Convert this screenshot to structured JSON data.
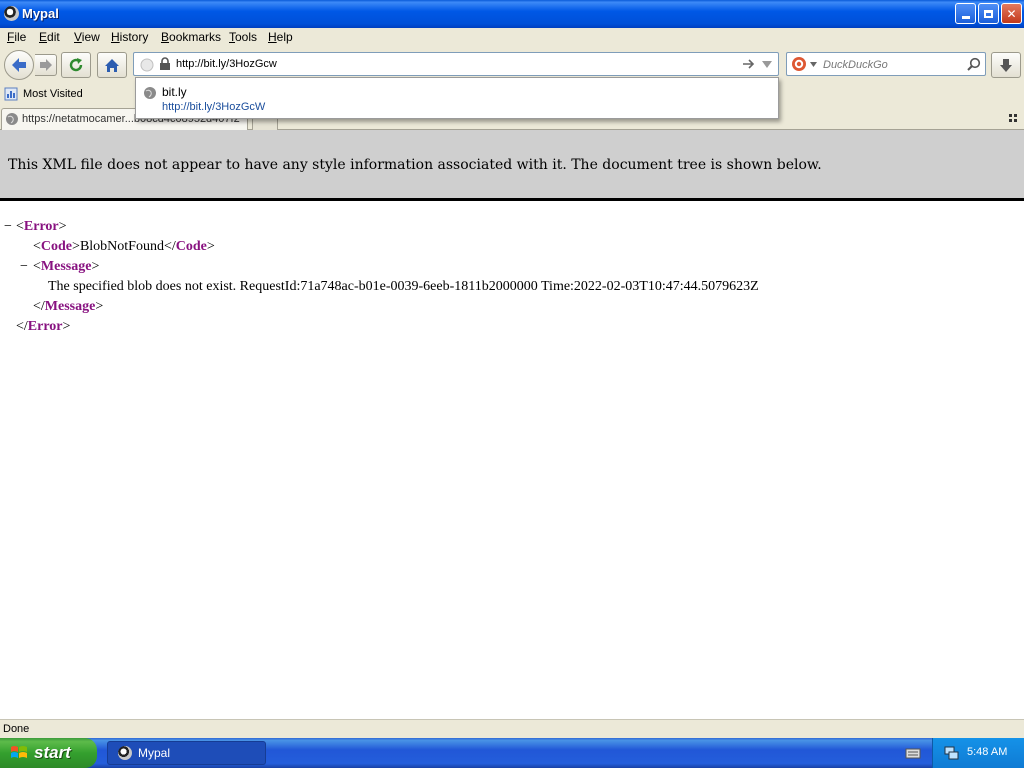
{
  "window": {
    "title": "Mypal"
  },
  "menu": [
    "File",
    "Edit",
    "View",
    "History",
    "Bookmarks",
    "Tools",
    "Help"
  ],
  "address_bar": {
    "value": "http://bit.ly/3HozGcw"
  },
  "search_bar": {
    "placeholder": "DuckDuckGo"
  },
  "bookmarks": {
    "most_visited": "Most Visited"
  },
  "tab": {
    "title": "https://netatmocamer...b08cd4c08952d407f2"
  },
  "autocomplete": {
    "title": "bit.ly",
    "url": "http://bit.ly/3HozGcW"
  },
  "xml_notice": "This XML file does not appear to have any style information associated with it. The document tree is shown below.",
  "xml": {
    "error_tag": "Error",
    "code_tag": "Code",
    "code_value": "BlobNotFound",
    "message_tag": "Message",
    "message_value": "The specified blob does not exist. RequestId:71a748ac-b01e-0039-6eeb-1811b2000000 Time:2022-02-03T10:47:44.5079623Z",
    "collapse_glyph": "−"
  },
  "status": "Done",
  "taskbar": {
    "start": "start",
    "task": "Mypal",
    "clock": "5:48 AM"
  },
  "colors": {
    "tag": "#881280",
    "title_bar": "#0058e6",
    "xml_header_bg": "#cfcfcf"
  }
}
